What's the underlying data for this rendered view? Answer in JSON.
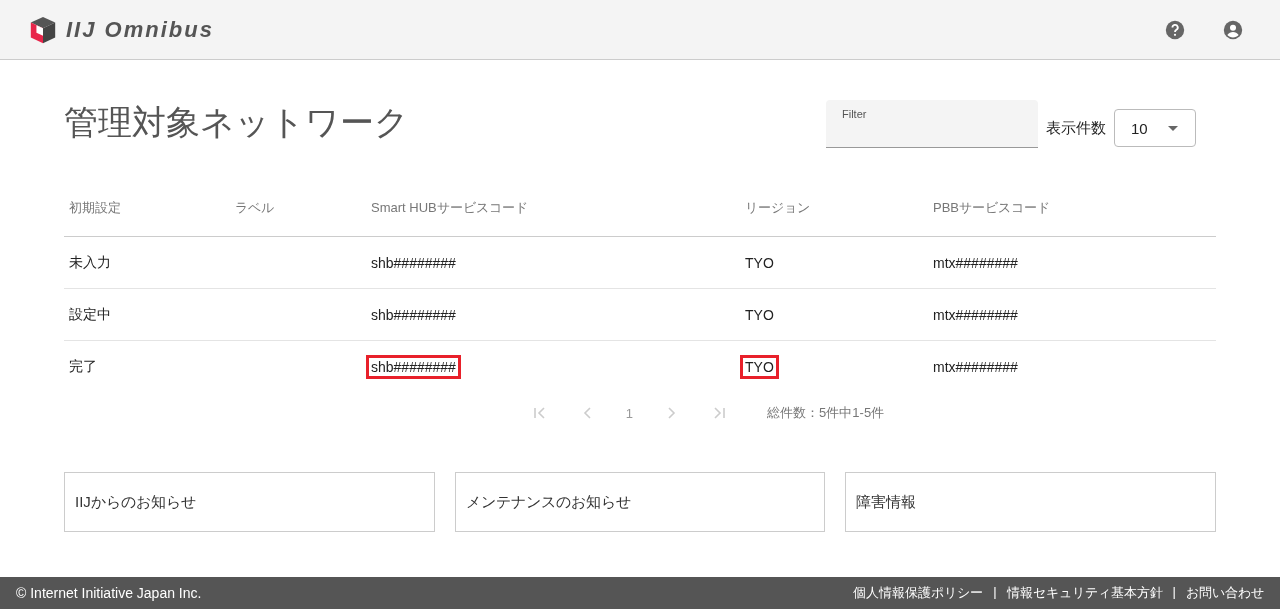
{
  "header": {
    "logo_text": "IIJ Omnibus"
  },
  "page_title": "管理対象ネットワーク",
  "filter": {
    "placeholder": "Filter"
  },
  "page_size": {
    "label": "表示件数",
    "value": "10"
  },
  "table": {
    "columns": [
      "初期設定",
      "ラベル",
      "Smart HUBサービスコード",
      "リージョン",
      "PBBサービスコード"
    ],
    "rows": [
      {
        "status": "未入力",
        "smart_hub": {
          "text": "shb########",
          "highlighted": false
        },
        "region": {
          "text": "TYO",
          "highlighted": false
        },
        "pbb": "mtx########"
      },
      {
        "status": "設定中",
        "smart_hub": {
          "text": "shb########",
          "highlighted": false
        },
        "region": {
          "text": "TYO",
          "highlighted": false
        },
        "pbb": "mtx########"
      },
      {
        "status": "完了",
        "smart_hub": {
          "text": "shb########",
          "highlighted": true
        },
        "region": {
          "text": "TYO",
          "highlighted": true
        },
        "pbb": "mtx########"
      }
    ]
  },
  "pagination": {
    "page": "1",
    "summary": "総件数：5件中1-5件"
  },
  "notices": [
    "IIJからのお知らせ",
    "メンテナンスのお知らせ",
    "障害情報"
  ],
  "footer": {
    "copyright": "© Internet Initiative Japan Inc.",
    "links": [
      "個人情報保護ポリシー",
      "情報セキュリティ基本方針",
      "お問い合わせ"
    ],
    "separator": "|"
  }
}
